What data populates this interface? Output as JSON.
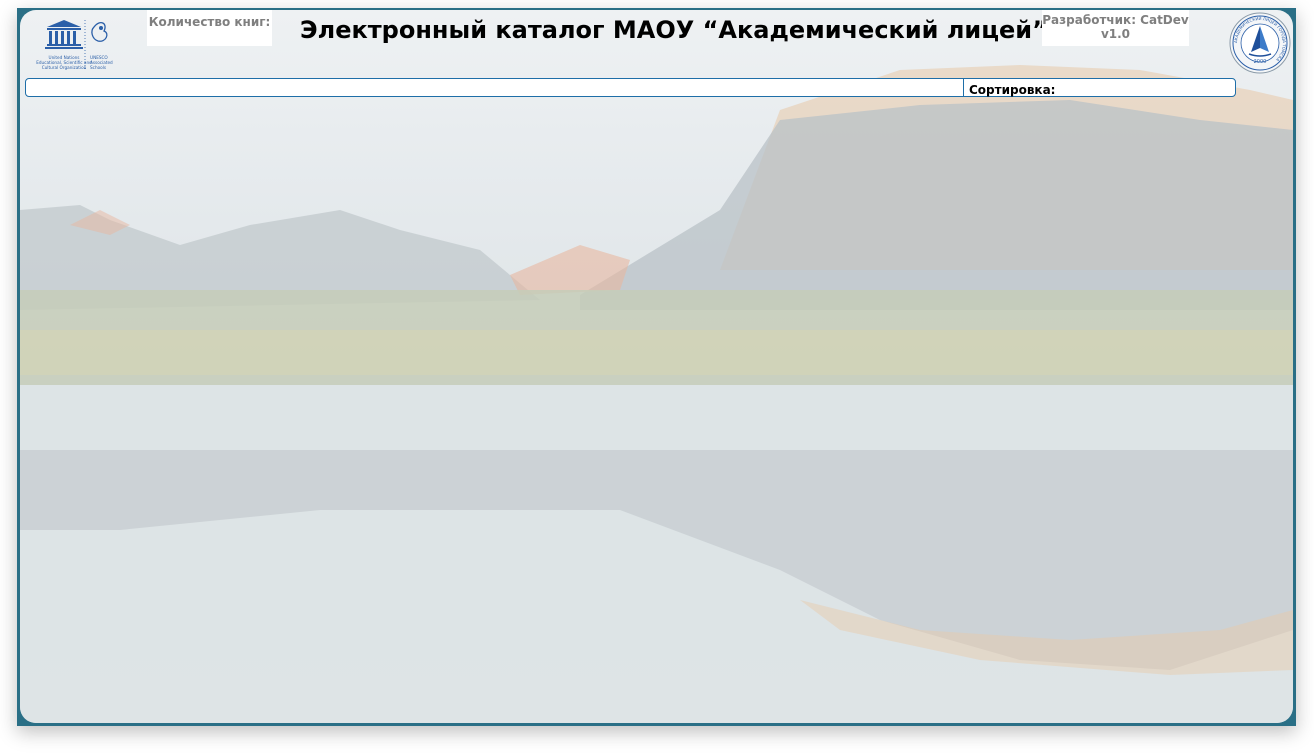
{
  "header": {
    "title": "Электронный каталог МАОУ “Академический лицей”",
    "books_count_label": "Количество книг:",
    "developer_label": "Разработчик: CatDev",
    "version": "v1.0"
  },
  "unesco": {
    "line1": "United Nations",
    "line2": "Educational, Scientific and",
    "line3": "Cultural Organization",
    "aside1": "UNESCO",
    "aside2": "Associated",
    "aside3": "Schools"
  },
  "emblem": {
    "ring_text": "АКАДЕМИЧЕСКИЙ ЛИЦЕЙ ГОРОДА ТОМСКА",
    "year": "2000"
  },
  "toolbar": {
    "search_value": "",
    "sort_label": "Сортировка:"
  },
  "colors": {
    "window_frame": "#2a6f86",
    "accent_border": "#1e6ea8",
    "panel_background": "#e4e9ec"
  }
}
